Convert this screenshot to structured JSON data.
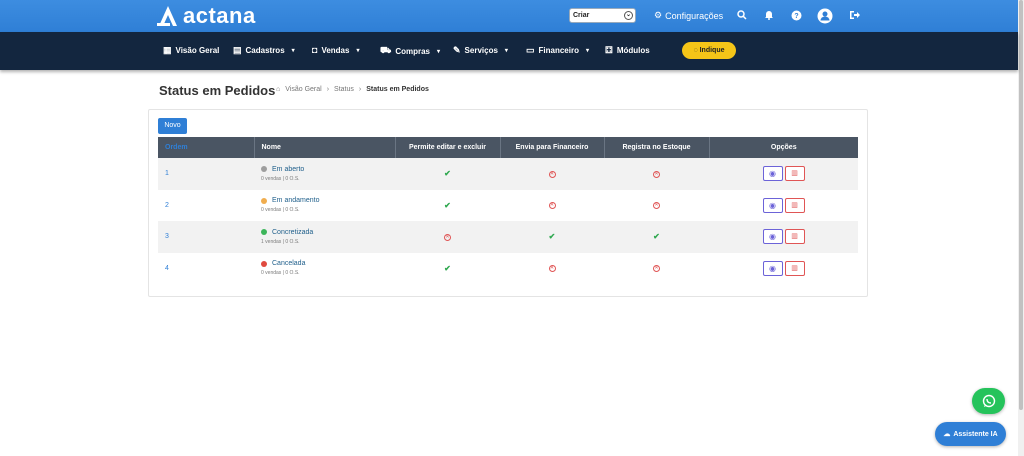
{
  "app": {
    "brand": "actana",
    "accent": "#2f7fd6",
    "nav_bg": "#13263f"
  },
  "topbar": {
    "criar": "Criar",
    "configuracoes": "Configurações",
    "icons": [
      "search-icon",
      "bell-icon",
      "help-icon",
      "user-avatar-icon",
      "logout-icon"
    ]
  },
  "nav": {
    "items": [
      {
        "label": "Visão Geral",
        "icon": "dashboard-icon",
        "dropdown": false
      },
      {
        "label": "Cadastros",
        "icon": "id-card-icon",
        "dropdown": true
      },
      {
        "label": "Vendas",
        "icon": "bag-icon",
        "dropdown": true
      },
      {
        "label": "Compras",
        "icon": "cart-icon",
        "dropdown": true
      },
      {
        "label": "Serviços",
        "icon": "wrench-icon",
        "dropdown": true
      },
      {
        "label": "Financeiro",
        "icon": "money-icon",
        "dropdown": true
      },
      {
        "label": "Módulos",
        "icon": "cubes-icon",
        "dropdown": false
      }
    ],
    "indique": "Indique"
  },
  "page": {
    "title": "Status em Pedidos",
    "breadcrumb": [
      "Visão Geral",
      "Status",
      "Status em Pedidos"
    ],
    "new_button": "Novo"
  },
  "table": {
    "headers": [
      "Ordem",
      "Nome",
      "Permite editar e excluir",
      "Envia para Financeiro",
      "Registra no Estoque",
      "Opções"
    ],
    "rows": [
      {
        "ordem": "1",
        "nome": "Em aberto",
        "cor": "#9e9e9e",
        "sub": "0 vendas | 0 O.S.",
        "editar": true,
        "financeiro": false,
        "estoque": false
      },
      {
        "ordem": "2",
        "nome": "Em andamento",
        "cor": "#f0ad4e",
        "sub": "0 vendas | 0 O.S.",
        "editar": true,
        "financeiro": false,
        "estoque": false
      },
      {
        "ordem": "3",
        "nome": "Concretizada",
        "cor": "#3cb55a",
        "sub": "1 vendas | 0 O.S.",
        "editar": false,
        "financeiro": true,
        "estoque": true
      },
      {
        "ordem": "4",
        "nome": "Cancelada",
        "cor": "#e04a3f",
        "sub": "0 vendas | 0 O.S.",
        "editar": true,
        "financeiro": false,
        "estoque": false
      }
    ]
  },
  "floating": {
    "assistente": "Assistente IA",
    "whatsapp_icon": "whatsapp-icon"
  }
}
